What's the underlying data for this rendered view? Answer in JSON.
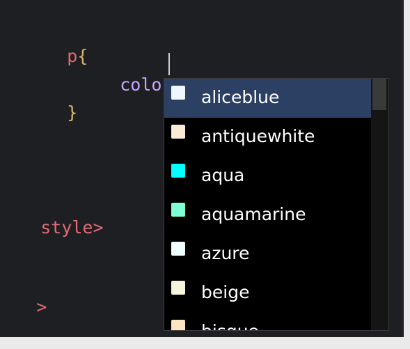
{
  "editor": {
    "lines": {
      "selector": "p",
      "open_brace": "{",
      "property": "color",
      "colon": ":",
      "close_brace": "}",
      "closing_style_tag": "style>",
      "closing_fragment": ">"
    }
  },
  "autocomplete": {
    "selected_index": 0,
    "items": [
      {
        "label": "aliceblue",
        "color": "#f0f8ff"
      },
      {
        "label": "antiquewhite",
        "color": "#faebd7"
      },
      {
        "label": "aqua",
        "color": "#00ffff"
      },
      {
        "label": "aquamarine",
        "color": "#7fffd4"
      },
      {
        "label": "azure",
        "color": "#f0ffff"
      },
      {
        "label": "beige",
        "color": "#f5f5dc"
      },
      {
        "label": "bisque",
        "color": "#ffe4c4"
      }
    ]
  }
}
